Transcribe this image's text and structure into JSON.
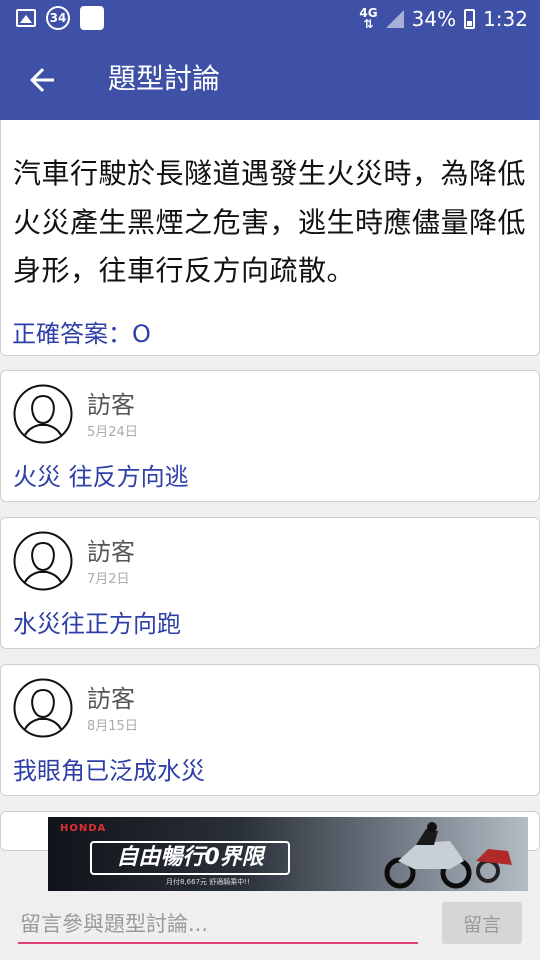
{
  "status_bar": {
    "notification_count": "34",
    "network": "4G",
    "battery": "34%",
    "time": "1:32"
  },
  "app_bar": {
    "title": "題型討論",
    "back_icon": "arrow-back-icon"
  },
  "question": {
    "text": "汽車行駛於長隧道遇發生火災時，為降低火災產生黑煙之危害，逃生時應儘量降低身形，往車行反方向疏散。",
    "answer": "正確答案：O"
  },
  "comments": [
    {
      "name": "訪客",
      "date": "5月24日",
      "body": "火災 往反方向逃"
    },
    {
      "name": "訪客",
      "date": "7月2日",
      "body": "水災往正方向跑"
    },
    {
      "name": "訪客",
      "date": "8月15日",
      "body": "我眼角已泛成水災"
    }
  ],
  "ad": {
    "brand": "HONDA",
    "headline": "自由暢行0界限",
    "subtext": "月付8,667元 舒適騎乘中!!"
  },
  "input": {
    "placeholder": "留言參與題型討論...",
    "value": "",
    "submit_label": "留言"
  },
  "colors": {
    "primary": "#3f51a7",
    "accent": "#e0407a",
    "link_text": "#2f3fa8"
  }
}
